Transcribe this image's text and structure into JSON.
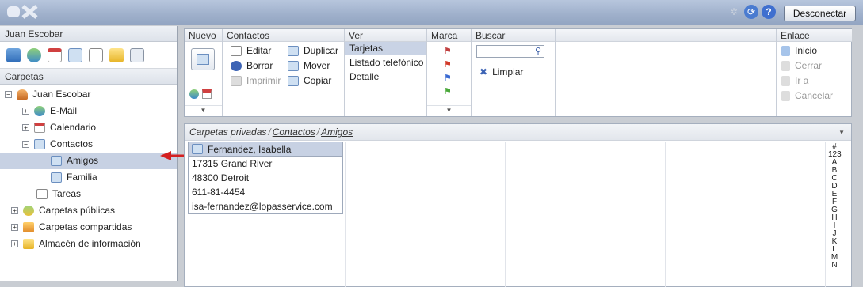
{
  "topbar": {
    "logo_text": "OX",
    "disconnect_label": "Desconectar",
    "icons": [
      "refresh-spinner-icon",
      "reload-icon",
      "help-icon"
    ]
  },
  "sidebar": {
    "user_name": "Juan Escobar",
    "modules": [
      "portal-icon",
      "email-icon",
      "calendar-icon",
      "contacts-icon",
      "tasks-icon",
      "infostore-icon",
      "search-icon"
    ],
    "folders_header": "Carpetas",
    "tree": [
      {
        "label": "Juan Escobar",
        "level": 0,
        "expander": "−"
      },
      {
        "label": "E-Mail",
        "level": 1,
        "expander": "+"
      },
      {
        "label": "Calendario",
        "level": 1,
        "expander": "+"
      },
      {
        "label": "Contactos",
        "level": 1,
        "expander": "−"
      },
      {
        "label": "Amigos",
        "level": 2,
        "expander": ""
      },
      {
        "label": "Familia",
        "level": 2,
        "expander": ""
      },
      {
        "label": "Tareas",
        "level": 1,
        "expander": ""
      },
      {
        "label": "Carpetas públicas",
        "level": 0,
        "expander": "+"
      },
      {
        "label": "Carpetas compartidas",
        "level": 0,
        "expander": "+"
      },
      {
        "label": "Almacén de información",
        "level": 0,
        "expander": "+"
      }
    ]
  },
  "toolbar": {
    "nuevo": {
      "title": "Nuevo"
    },
    "contactos": {
      "title": "Contactos",
      "editar": "Editar",
      "borrar": "Borrar",
      "imprimir": "Imprimir",
      "duplicar": "Duplicar",
      "mover": "Mover",
      "copiar": "Copiar"
    },
    "ver": {
      "title": "Ver",
      "tarjetas": "Tarjetas",
      "listado": "Listado telefónico",
      "detalle": "Detalle"
    },
    "marca": {
      "title": "Marca"
    },
    "buscar": {
      "title": "Buscar",
      "limpiar": "Limpiar",
      "placeholder": ""
    },
    "enlace": {
      "title": "Enlace",
      "inicio": "Inicio",
      "cerrar": "Cerrar",
      "ira": "Ir a",
      "cancelar": "Cancelar"
    }
  },
  "content": {
    "crumb_root": "Carpetas privadas",
    "crumb_mid": "Contactos",
    "crumb_leaf": "Amigos",
    "card": {
      "name": "Fernandez, Isabella",
      "street": "17315 Grand River",
      "city": "48300 Detroit",
      "phone": "611-81-4454",
      "email": "isa-fernandez@lopasservice.com"
    },
    "alphabet": [
      "#",
      "123",
      "A",
      "B",
      "C",
      "D",
      "E",
      "F",
      "G",
      "H",
      "I",
      "J",
      "K",
      "L",
      "M",
      "N"
    ]
  },
  "colors": {
    "selection": "#c7d1e3",
    "topbar": "#9fb0cb",
    "arrow": "#d42020"
  }
}
